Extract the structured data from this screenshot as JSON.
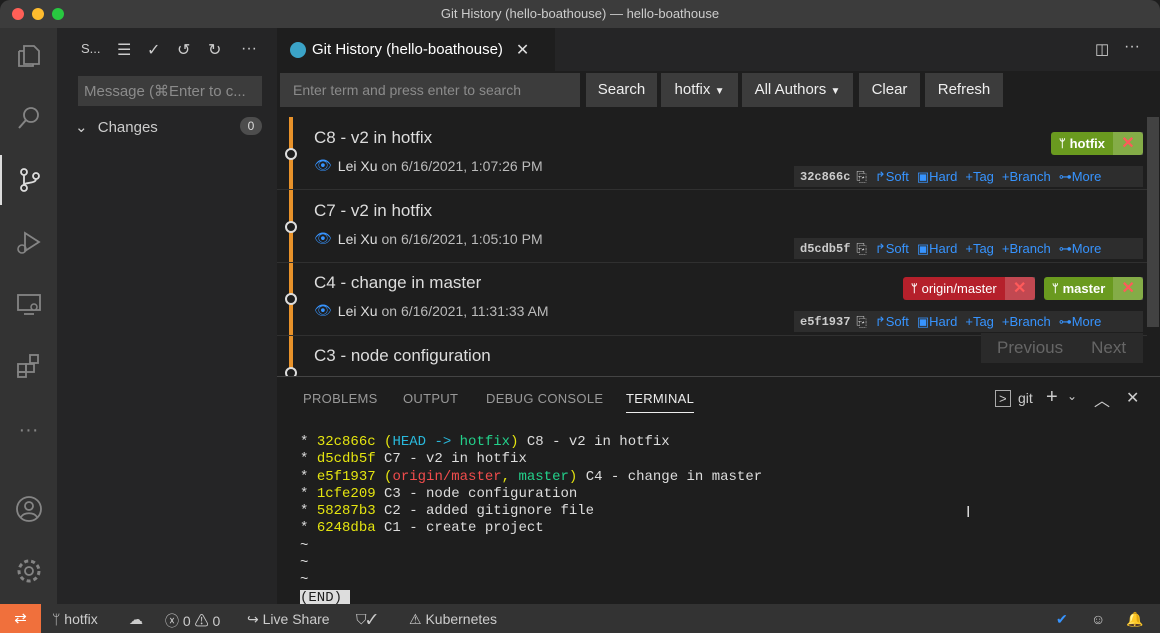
{
  "window": {
    "title": "Git History (hello-boathouse) — hello-boathouse"
  },
  "sidebar": {
    "title": "S...",
    "message_placeholder": "Message (⌘Enter to c...",
    "changes_label": "Changes",
    "changes_count": "0"
  },
  "tab": {
    "title": "Git History (hello-boathouse)"
  },
  "toolbar": {
    "search_placeholder": "Enter term and press enter to search",
    "search_label": "Search",
    "branch_label": "hotfix",
    "authors_label": "All Authors",
    "clear_label": "Clear",
    "refresh_label": "Refresh"
  },
  "commits": [
    {
      "title": "C8 - v2 in hotfix",
      "author": "Lei Xu",
      "date": "on 6/16/2021, 1:07:26 PM",
      "hash": "32c866c"
    },
    {
      "title": "C7 - v2 in hotfix",
      "author": "Lei Xu",
      "date": "on 6/16/2021, 1:05:10 PM",
      "hash": "d5cdb5f"
    },
    {
      "title": "C4 - change in master",
      "author": "Lei Xu",
      "date": "on 6/16/2021, 11:31:33 AM",
      "hash": "e5f1937"
    },
    {
      "title": "C3 - node configuration"
    }
  ],
  "actions": {
    "soft": "Soft",
    "hard": "Hard",
    "tag": "Tag",
    "branch": "Branch",
    "more": "More"
  },
  "refs": {
    "hotfix": "hotfix",
    "origin_master": "origin/master",
    "master": "master"
  },
  "pager": {
    "previous": "Previous",
    "next": "Next"
  },
  "panel": {
    "tabs": [
      "PROBLEMS",
      "OUTPUT",
      "DEBUG CONSOLE",
      "TERMINAL"
    ],
    "shell": "git"
  },
  "terminal": {
    "l1": {
      "hash": "32c866c",
      "head": "HEAD",
      "arrow": " -> ",
      "branch": "hotfix",
      "msg": " C8 - v2 in hotfix"
    },
    "l2": {
      "hash": "d5cdb5f",
      "msg": " C7 - v2 in hotfix"
    },
    "l3": {
      "hash": "e5f1937",
      "origin": "origin/master",
      "branch": "master",
      "msg": " C4 - change in master"
    },
    "l4": {
      "hash": "1cfe209",
      "msg": " C3 - node configuration"
    },
    "l5": {
      "hash": "58287b3",
      "msg": " C2 - added gitignore file"
    },
    "l6": {
      "hash": "6248dba",
      "msg": " C1 - create project"
    },
    "end": "(END)"
  },
  "status": {
    "branch": "hotfix",
    "errors": "0",
    "warnings": "0",
    "live_share": "Live Share",
    "kubernetes": "Kubernetes"
  },
  "colors": {
    "accent": "#3794ff",
    "remote_indicator": "#f0703c",
    "graph": "#e8922a",
    "tag_green": "#6a9a1f",
    "tag_red": "#b5202b"
  }
}
